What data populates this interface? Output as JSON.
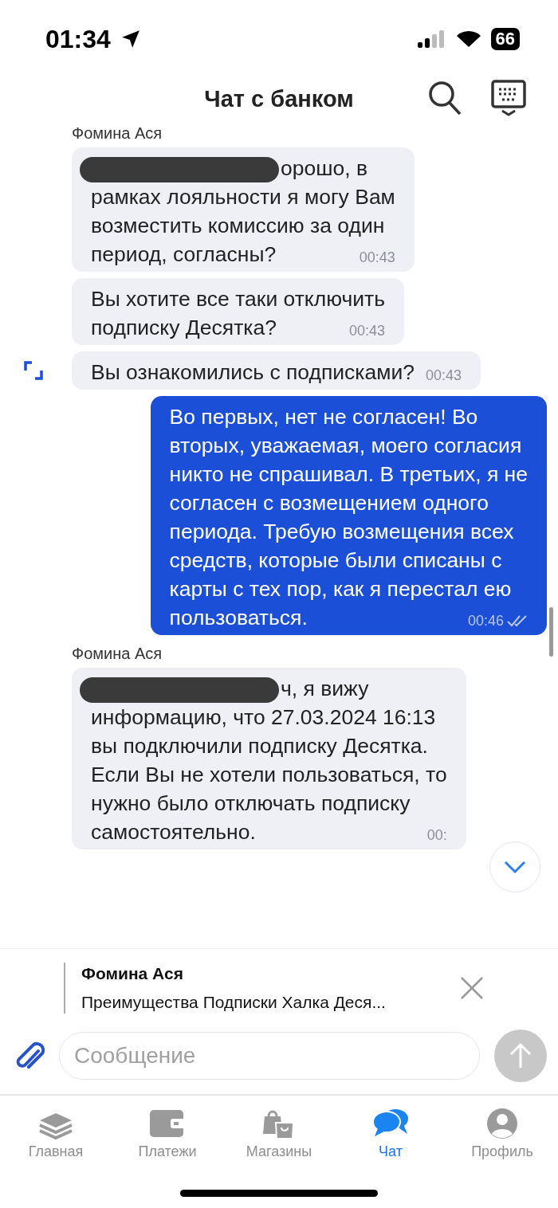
{
  "status_bar": {
    "time": "01:34",
    "battery": "66"
  },
  "header": {
    "title": "Чат с банком"
  },
  "messages": [
    {
      "kind": "incoming",
      "sender": "Фомина Ася",
      "redacted": true,
      "expand_icon": false,
      "text": "орошо, в\nрамках лояльности я могу Вам\nвозместить комиссию за один\nпериод, согласны?",
      "time": "00:43"
    },
    {
      "kind": "incoming",
      "redacted": false,
      "expand_icon": false,
      "text": "Вы хотите все таки отключить\nподписку Десятка?",
      "time": "00:43"
    },
    {
      "kind": "incoming",
      "redacted": false,
      "expand_icon": true,
      "text": "Вы ознакомились с подписками?",
      "time": "00:43"
    },
    {
      "kind": "outgoing",
      "read": true,
      "text": "Во первых, нет не согласен! Во\nвторых, уважаемая, моего согласия\nникто не спрашивал. В третьих, я не\nсогласен с возмещением одного\nпериода. Требую возмещения всех\nсредств, которые были списаны с\nкарты с тех пор, как я перестал ею\nпользоваться.",
      "time": "00:46"
    },
    {
      "kind": "incoming",
      "sender": "Фомина Ася",
      "redacted": true,
      "expand_icon": false,
      "text": "ч, я вижу\nинформацию, что 27.03.2024 16:13\nвы подключили подписку Десятка.\nЕсли Вы не хотели пользоваться, то\nнужно было отключать подписку\nсамостоятельно.",
      "time": "00:"
    }
  ],
  "reply_preview": {
    "sender": "Фомина Ася",
    "text": "Преимущества Подписки Халка Деся..."
  },
  "composer": {
    "placeholder": "Сообщение"
  },
  "tabs": [
    {
      "label": "Главная",
      "selected": false
    },
    {
      "label": "Платежи",
      "selected": false
    },
    {
      "label": "Магазины",
      "selected": false
    },
    {
      "label": "Чат",
      "selected": true
    },
    {
      "label": "Профиль",
      "selected": false
    }
  ]
}
